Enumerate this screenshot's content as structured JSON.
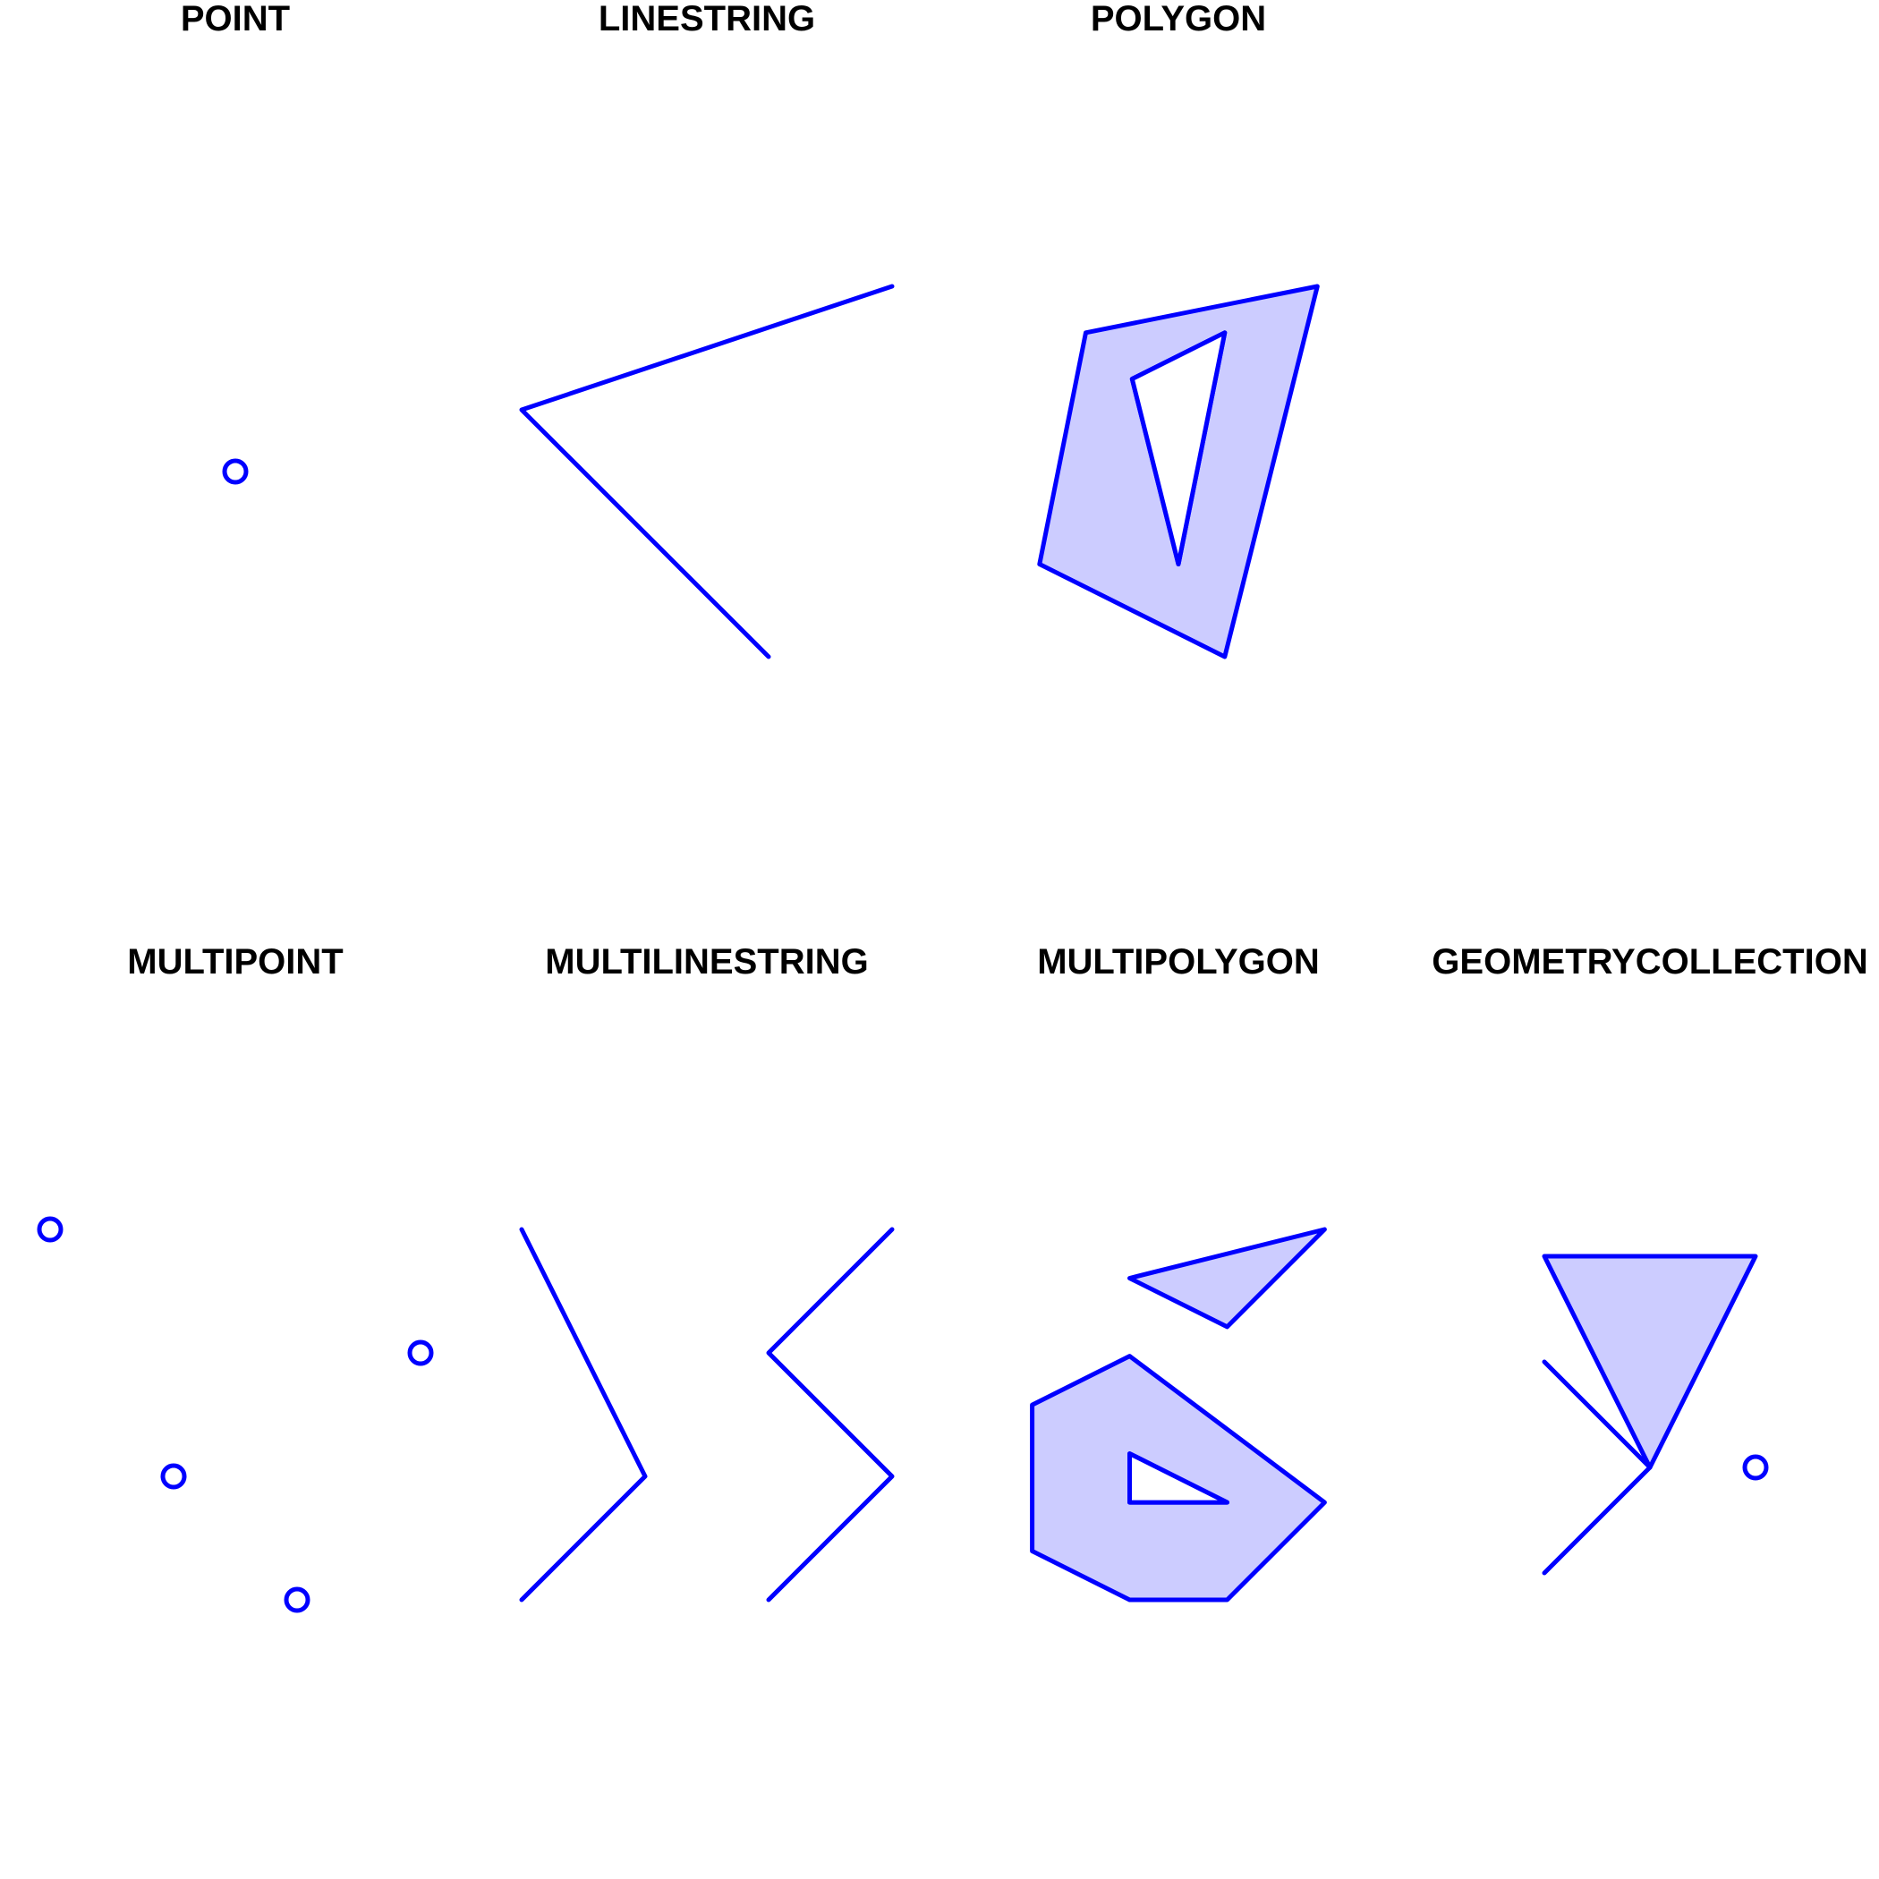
{
  "colors": {
    "stroke": "#0000FF",
    "fill": "#CCCCFF",
    "hole": "#FFFFFF",
    "background": "#FFFFFF"
  },
  "panels": [
    {
      "title": "POINT",
      "geometries": [
        {
          "type": "point",
          "coords": [
            [
              1,
              1
            ]
          ]
        }
      ]
    },
    {
      "title": "LINESTRING",
      "geometries": [
        {
          "type": "line",
          "coords": [
            [
              3,
              2
            ],
            [
              1,
              4
            ],
            [
              4,
              5
            ]
          ]
        }
      ]
    },
    {
      "title": "POLYGON",
      "geometries": [
        {
          "type": "polygon",
          "outer": [
            [
              1,
              2
            ],
            [
              3,
              1
            ],
            [
              4,
              5
            ],
            [
              1.5,
              4.5
            ],
            [
              1,
              2
            ]
          ],
          "holes": [
            [
              [
                2,
                4
              ],
              [
                2.5,
                2
              ],
              [
                3,
                4.5
              ],
              [
                2,
                4
              ]
            ]
          ]
        }
      ]
    },
    {
      "title": "MULTIPOINT",
      "geometries": [
        {
          "type": "point",
          "coords": [
            [
              1,
              4
            ]
          ]
        },
        {
          "type": "point",
          "coords": [
            [
              4,
              3
            ]
          ]
        },
        {
          "type": "point",
          "coords": [
            [
              2,
              2
            ]
          ]
        },
        {
          "type": "point",
          "coords": [
            [
              3,
              1
            ]
          ]
        }
      ]
    },
    {
      "title": "MULTILINESTRING",
      "geometries": [
        {
          "type": "line",
          "coords": [
            [
              1,
              1
            ],
            [
              2,
              2
            ],
            [
              1,
              4
            ]
          ]
        },
        {
          "type": "line",
          "coords": [
            [
              3,
              1
            ],
            [
              4,
              2
            ],
            [
              3,
              3
            ],
            [
              4,
              4
            ]
          ]
        }
      ]
    },
    {
      "title": "MULTIPOLYGON",
      "geometries": [
        {
          "type": "polygon",
          "outer": [
            [
              2,
              4.3
            ],
            [
              3,
              3.8
            ],
            [
              4,
              4.8
            ],
            [
              2,
              4.3
            ]
          ],
          "holes": []
        },
        {
          "type": "polygon",
          "outer": [
            [
              1,
              1.5
            ],
            [
              2,
              1
            ],
            [
              3,
              1
            ],
            [
              4,
              2
            ],
            [
              2,
              3.5
            ],
            [
              1,
              3
            ],
            [
              1,
              1.5
            ]
          ],
          "holes": [
            [
              [
                2,
                2
              ],
              [
                3,
                2
              ],
              [
                2,
                2.5
              ],
              [
                2,
                2
              ]
            ]
          ]
        }
      ]
    },
    {
      "title": "GEOMETRYCOLLECTION",
      "geometries": [
        {
          "type": "line",
          "coords": [
            [
              1,
              1
            ],
            [
              2,
              2
            ],
            [
              1,
              3
            ]
          ]
        },
        {
          "type": "polygon",
          "outer": [
            [
              1,
              4
            ],
            [
              2,
              2
            ],
            [
              3,
              4
            ],
            [
              1,
              4
            ]
          ],
          "holes": []
        },
        {
          "type": "point",
          "coords": [
            [
              3,
              2
            ]
          ]
        }
      ]
    }
  ]
}
